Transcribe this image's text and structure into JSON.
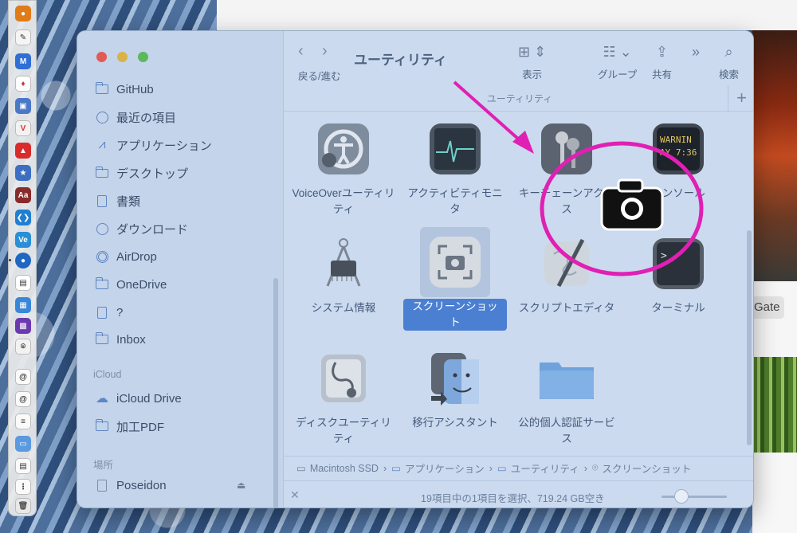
{
  "background": {
    "gate_button_label": "Gate"
  },
  "dock": {
    "icons": [
      "app-icon",
      "textedit-icon",
      "app-icon",
      "app-icon",
      "app-icon",
      "vivaldi-icon",
      "app-icon",
      "app-icon",
      "dictionary-icon",
      "vscode-icon",
      "app-icon",
      "app-icon",
      "app-icon",
      "app-icon",
      "app-icon",
      "screenshot-icon",
      "mail-icon",
      "mail-icon",
      "document-icon",
      "folder-icon",
      "document-icon",
      "document-icon",
      "trash-icon"
    ]
  },
  "sidebar": {
    "favorites": [
      {
        "label": "GitHub",
        "icon": "folder-icon"
      },
      {
        "label": "最近の項目",
        "icon": "clock-icon"
      },
      {
        "label": "アプリケーション",
        "icon": "applications-icon"
      },
      {
        "label": "デスクトップ",
        "icon": "desktop-icon"
      },
      {
        "label": "書類",
        "icon": "document-icon"
      },
      {
        "label": "ダウンロード",
        "icon": "download-icon"
      },
      {
        "label": "AirDrop",
        "icon": "airdrop-icon"
      },
      {
        "label": "OneDrive",
        "icon": "folder-icon"
      },
      {
        "label": "?",
        "icon": "document-icon"
      },
      {
        "label": "Inbox",
        "icon": "folder-icon"
      }
    ],
    "icloud_header": "iCloud",
    "icloud": [
      {
        "label": "iCloud Drive",
        "icon": "cloud-icon"
      },
      {
        "label": "加工PDF",
        "icon": "folder-icon"
      }
    ],
    "locations_header": "場所",
    "locations": [
      {
        "label": "Poseidon",
        "icon": "device-icon"
      }
    ]
  },
  "toolbar": {
    "back_forward_label": "戻る/進む",
    "title": "ユーティリティ",
    "view_label": "表示",
    "group_label": "グループ",
    "share_label": "共有",
    "search_label": "検索"
  },
  "path_header": "ユーティリティ",
  "items": [
    {
      "name": "VoiceOverユーティリティ",
      "icon": "voiceover-icon"
    },
    {
      "name": "アクティビティモニタ",
      "icon": "activity-monitor-icon"
    },
    {
      "name": "キーチェーンアクセス",
      "icon": "keychain-icon"
    },
    {
      "name": "コンソール",
      "icon": "console-icon",
      "text": "WARNIN\nAY 7:36"
    },
    {
      "name": "システム情報",
      "icon": "system-info-icon"
    },
    {
      "name": "スクリーンショット",
      "icon": "screenshot-icon",
      "selected": true
    },
    {
      "name": "スクリプトエディタ",
      "icon": "script-editor-icon"
    },
    {
      "name": "ターミナル",
      "icon": "terminal-icon",
      "text": ">_"
    },
    {
      "name": "ディスクユーティリティ",
      "icon": "disk-utility-icon"
    },
    {
      "name": "移行アシスタント",
      "icon": "migration-assistant-icon"
    },
    {
      "name": "公的個人認証サービス",
      "icon": "folder-icon"
    }
  ],
  "pathbar": {
    "segments": [
      "Macintosh SSD",
      "アプリケーション",
      "ユーティリティ",
      "スクリーンショット"
    ]
  },
  "status": {
    "text": "19項目中の1項目を選択、719.24 GB空き",
    "icon_zoom_level": 0.3
  },
  "annotation": {
    "color": "#e020b4"
  }
}
